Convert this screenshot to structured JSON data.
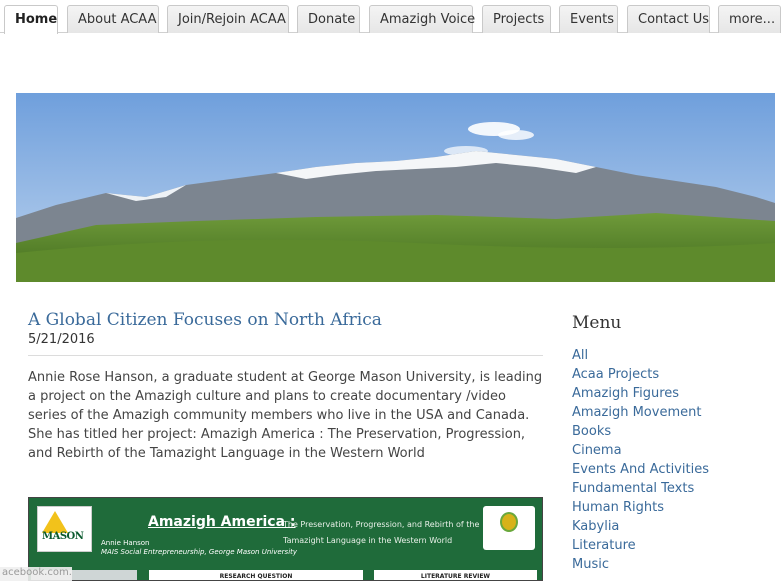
{
  "nav": {
    "tabs": [
      {
        "label": "Home"
      },
      {
        "label": "About ACAA"
      },
      {
        "label": "Join/Rejoin ACAA"
      },
      {
        "label": "Donate"
      },
      {
        "label": "Amazigh Voice"
      },
      {
        "label": "Projects"
      },
      {
        "label": "Events"
      },
      {
        "label": "Contact Us"
      },
      {
        "label": "more..."
      }
    ],
    "active_tab": "Home"
  },
  "article": {
    "title": "A Global Citizen Focuses on North Africa",
    "date": "5/21/2016",
    "body": "Annie Rose Hanson, a graduate student at George Mason University, is leading a project on the Amazigh culture and plans to create documentary /video series of the Amazigh community members who live in the USA and Canada. She has titled her project: Amazigh America : The Preservation, Progression, and Rebirth of the Tamazight Language in the Western World"
  },
  "poster": {
    "logo_text": "MASON",
    "title": "Amazigh America :",
    "subtitle": "The Preservation, Progression, and Rebirth of the Tamazight Language in the Western World",
    "author": "Annie Hanson",
    "affiliation": "MAIS Social Entrepreneurship, George Mason University",
    "panel_research": "RESEARCH QUESTION",
    "panel_literature": "LITERATURE REVIEW"
  },
  "sidebar": {
    "heading": "Menu",
    "items": [
      {
        "label": "All"
      },
      {
        "label": "Acaa Projects"
      },
      {
        "label": "Amazigh Figures"
      },
      {
        "label": "Amazigh Movement"
      },
      {
        "label": "Books"
      },
      {
        "label": "Cinema"
      },
      {
        "label": "Events And Activities"
      },
      {
        "label": "Fundamental Texts"
      },
      {
        "label": "Human Rights"
      },
      {
        "label": "Kabylia"
      },
      {
        "label": "Literature"
      },
      {
        "label": "Music"
      }
    ]
  },
  "footer": {
    "facebook_stub": "acebook.com..."
  },
  "colors": {
    "link": "#3a6a9a",
    "poster_green": "#1f6b3a",
    "tab_bg": "#e6e6e6"
  }
}
